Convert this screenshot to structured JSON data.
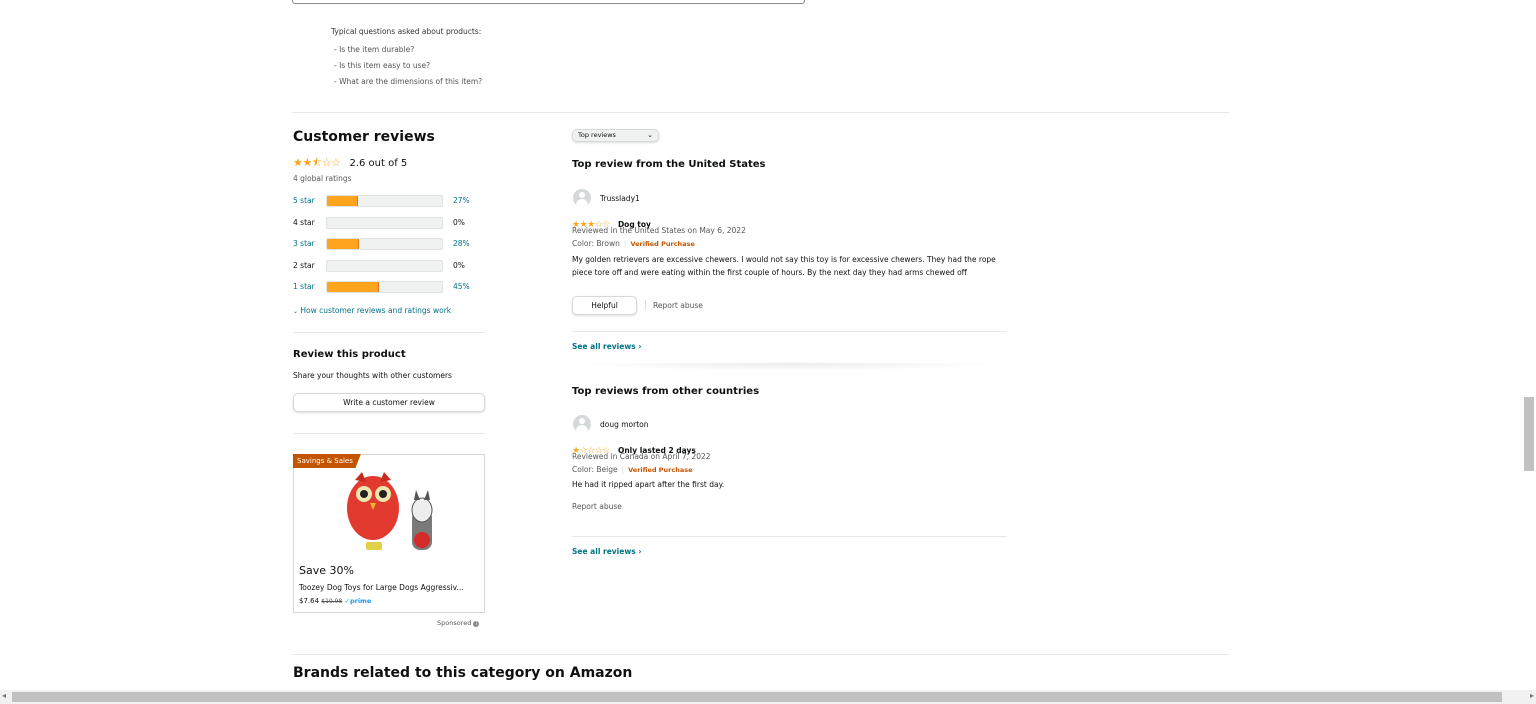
{
  "questions": {
    "intro": "Typical questions asked about products:",
    "items": [
      "Is the item durable?",
      "Is this item easy to use?",
      "What are the dimensions of this item?"
    ]
  },
  "reviews_summary": {
    "title": "Customer reviews",
    "stars": "★★⯪☆☆",
    "rating_text": "2.6 out of 5",
    "global_ratings": "4 global ratings",
    "histogram": [
      {
        "label": "5 star",
        "percent_text": "27%",
        "fraction": 0.27
      },
      {
        "label": "4 star",
        "percent_text": "0%",
        "fraction": 0.0
      },
      {
        "label": "3 star",
        "percent_text": "28%",
        "fraction": 0.28
      },
      {
        "label": "2 star",
        "percent_text": "0%",
        "fraction": 0.0
      },
      {
        "label": "1 star",
        "percent_text": "45%",
        "fraction": 0.45
      }
    ],
    "how_work_link": "How customer reviews and ratings work"
  },
  "review_product": {
    "title": "Review this product",
    "subtitle": "Share your thoughts with other customers",
    "button": "Write a customer review"
  },
  "ad": {
    "badge": "Savings & Sales",
    "save": "Save 30%",
    "title": "Toozey Dog Toys for Large Dogs Aggressiv...",
    "price": "$7.64",
    "list_price": "$10.98",
    "prime": "prime",
    "sponsored": "Sponsored"
  },
  "sort": {
    "selected": "Top reviews"
  },
  "us_section": {
    "title": "Top review from the United States",
    "review": {
      "author": "Trusslady1",
      "stars": "★★★☆☆",
      "headline": "Dog toy",
      "meta": "Reviewed in the United States on May 6, 2022",
      "color": "Color: Brown",
      "verified": "Verified Purchase",
      "body": "My golden retrievers are excessive chewers. I would not say this toy is for excessive chewers. They had the rope piece tore off and were eating within the first couple of hours. By the next day they had arms chewed off",
      "helpful": "Helpful",
      "report": "Report abuse"
    },
    "see_all": "See all reviews ›"
  },
  "other_section": {
    "title": "Top reviews from other countries",
    "review": {
      "author": "doug morton",
      "stars": "★☆☆☆☆",
      "headline": "Only lasted 2 days",
      "meta": "Reviewed in Canada on April 7, 2022",
      "color": "Color: Beige",
      "verified": "Verified Purchase",
      "body": "He had it ripped apart after the first day.",
      "report": "Report abuse"
    },
    "see_all": "See all reviews ›"
  },
  "brands": {
    "title": "Brands related to this category on Amazon"
  },
  "colors": {
    "star": "#ffa41c",
    "link": "#007185",
    "verified": "#c45500"
  }
}
